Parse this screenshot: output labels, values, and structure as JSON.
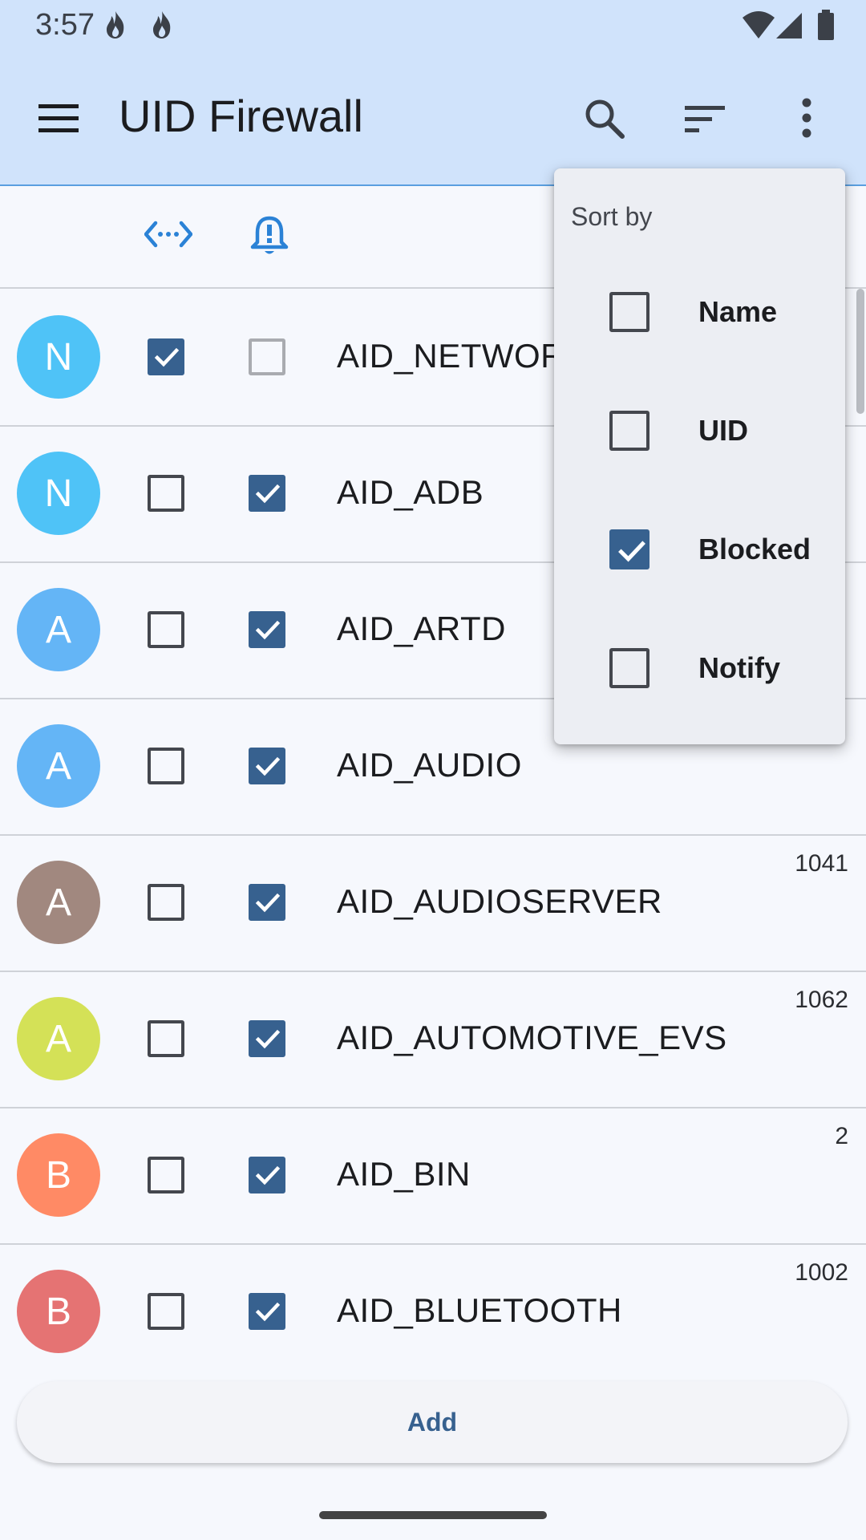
{
  "status_bar": {
    "time": "3:57"
  },
  "app_bar": {
    "title": "UID Firewall"
  },
  "colors": {
    "accent": "#37618f",
    "app_bar_bg": "#d0e3fb",
    "header_icon": "#2b82d6"
  },
  "icons": {
    "menu": "hamburger-icon",
    "search": "search-icon",
    "sort": "sort-icon",
    "more": "more-vert-icon",
    "network_column": "network-icon",
    "notify_column": "bell-icon"
  },
  "rows": [
    {
      "letter": "N",
      "name": "AID_NETWORK",
      "uid": "",
      "avatar_color": "#4fc3f7",
      "checkbox_a": true,
      "checkbox_b": false,
      "checkbox_b_disabled": true
    },
    {
      "letter": "N",
      "name": "AID_ADB",
      "uid": "",
      "avatar_color": "#4fc3f7",
      "checkbox_a": false,
      "checkbox_b": true
    },
    {
      "letter": "A",
      "name": "AID_ARTD",
      "uid": "",
      "avatar_color": "#64b5f6",
      "checkbox_a": false,
      "checkbox_b": true
    },
    {
      "letter": "A",
      "name": "AID_AUDIO",
      "uid": "",
      "avatar_color": "#64b5f6",
      "checkbox_a": false,
      "checkbox_b": true
    },
    {
      "letter": "A",
      "name": "AID_AUDIOSERVER",
      "uid": "1041",
      "avatar_color": "#a1887f",
      "checkbox_a": false,
      "checkbox_b": true
    },
    {
      "letter": "A",
      "name": "AID_AUTOMOTIVE_EVS",
      "uid": "1062",
      "avatar_color": "#d4e157",
      "checkbox_a": false,
      "checkbox_b": true
    },
    {
      "letter": "B",
      "name": "AID_BIN",
      "uid": "2",
      "avatar_color": "#ff8a65",
      "checkbox_a": false,
      "checkbox_b": true
    },
    {
      "letter": "B",
      "name": "AID_BLUETOOTH",
      "uid": "1002",
      "avatar_color": "#e57373",
      "checkbox_a": false,
      "checkbox_b": true
    }
  ],
  "sort_menu": {
    "header": "Sort by",
    "items": [
      {
        "label": "Name",
        "checked": false
      },
      {
        "label": "UID",
        "checked": false
      },
      {
        "label": "Blocked",
        "checked": true
      },
      {
        "label": "Notify",
        "checked": false
      }
    ]
  },
  "add_button": {
    "label": "Add"
  }
}
